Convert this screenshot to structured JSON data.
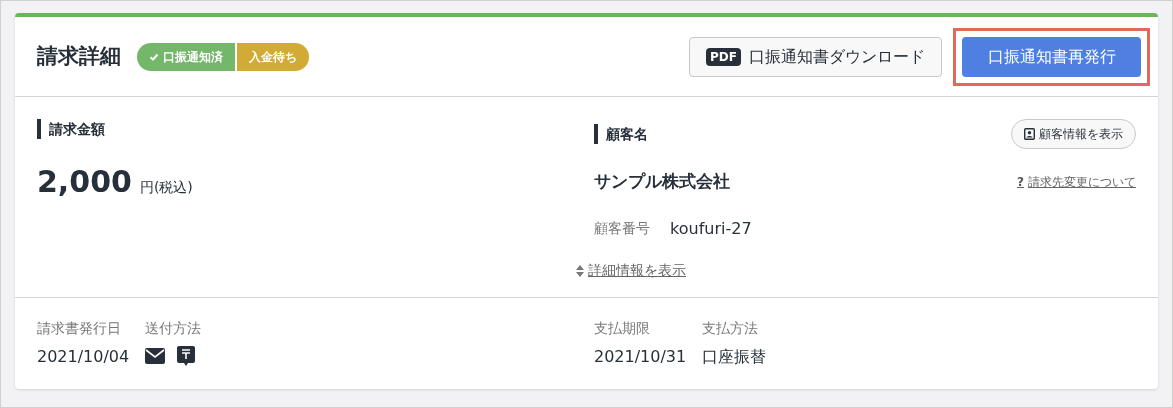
{
  "header": {
    "title": "請求詳細",
    "badges": [
      {
        "label": "口振通知済",
        "checked": true,
        "color": "#74b66a"
      },
      {
        "label": "入金待ち",
        "checked": false,
        "color": "#d2aa36"
      }
    ],
    "buttons": [
      {
        "kind": "pdf",
        "icon_text": "PDF",
        "label": "口振通知書ダウンロード",
        "highlighted": false
      },
      {
        "kind": "primary",
        "label": "口振通知書再発行",
        "highlighted": true
      }
    ]
  },
  "amount": {
    "heading": "請求金額",
    "value": "2,000",
    "unit": "円(税込)"
  },
  "customer": {
    "heading": "顧客名",
    "show_button": "顧客情報を表示",
    "name": "サンプル株式会社",
    "help_icon": "?",
    "help_link": "請求先変更について",
    "id_label": "顧客番号",
    "id_value": "koufuri-27"
  },
  "details_link": "詳細情報を表示",
  "footer": {
    "left": [
      {
        "label": "請求書発行日",
        "value": "2021/10/04"
      },
      {
        "label": "送付方法",
        "icons": [
          {
            "kind": "mail"
          },
          {
            "kind": "post"
          }
        ]
      }
    ],
    "right": [
      {
        "label": "支払期限",
        "value": "2021/10/31"
      },
      {
        "label": "支払方法",
        "value": "口座振替"
      }
    ]
  }
}
